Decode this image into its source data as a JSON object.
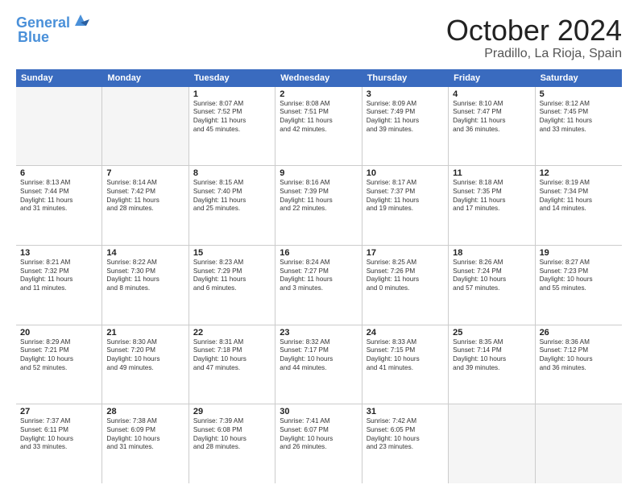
{
  "header": {
    "logo_line1": "General",
    "logo_line2": "Blue",
    "month": "October 2024",
    "location": "Pradillo, La Rioja, Spain"
  },
  "weekdays": [
    "Sunday",
    "Monday",
    "Tuesday",
    "Wednesday",
    "Thursday",
    "Friday",
    "Saturday"
  ],
  "rows": [
    [
      {
        "day": "",
        "lines": [],
        "empty": true
      },
      {
        "day": "",
        "lines": [],
        "empty": true
      },
      {
        "day": "1",
        "lines": [
          "Sunrise: 8:07 AM",
          "Sunset: 7:52 PM",
          "Daylight: 11 hours",
          "and 45 minutes."
        ]
      },
      {
        "day": "2",
        "lines": [
          "Sunrise: 8:08 AM",
          "Sunset: 7:51 PM",
          "Daylight: 11 hours",
          "and 42 minutes."
        ]
      },
      {
        "day": "3",
        "lines": [
          "Sunrise: 8:09 AM",
          "Sunset: 7:49 PM",
          "Daylight: 11 hours",
          "and 39 minutes."
        ]
      },
      {
        "day": "4",
        "lines": [
          "Sunrise: 8:10 AM",
          "Sunset: 7:47 PM",
          "Daylight: 11 hours",
          "and 36 minutes."
        ]
      },
      {
        "day": "5",
        "lines": [
          "Sunrise: 8:12 AM",
          "Sunset: 7:45 PM",
          "Daylight: 11 hours",
          "and 33 minutes."
        ]
      }
    ],
    [
      {
        "day": "6",
        "lines": [
          "Sunrise: 8:13 AM",
          "Sunset: 7:44 PM",
          "Daylight: 11 hours",
          "and 31 minutes."
        ]
      },
      {
        "day": "7",
        "lines": [
          "Sunrise: 8:14 AM",
          "Sunset: 7:42 PM",
          "Daylight: 11 hours",
          "and 28 minutes."
        ]
      },
      {
        "day": "8",
        "lines": [
          "Sunrise: 8:15 AM",
          "Sunset: 7:40 PM",
          "Daylight: 11 hours",
          "and 25 minutes."
        ]
      },
      {
        "day": "9",
        "lines": [
          "Sunrise: 8:16 AM",
          "Sunset: 7:39 PM",
          "Daylight: 11 hours",
          "and 22 minutes."
        ]
      },
      {
        "day": "10",
        "lines": [
          "Sunrise: 8:17 AM",
          "Sunset: 7:37 PM",
          "Daylight: 11 hours",
          "and 19 minutes."
        ]
      },
      {
        "day": "11",
        "lines": [
          "Sunrise: 8:18 AM",
          "Sunset: 7:35 PM",
          "Daylight: 11 hours",
          "and 17 minutes."
        ]
      },
      {
        "day": "12",
        "lines": [
          "Sunrise: 8:19 AM",
          "Sunset: 7:34 PM",
          "Daylight: 11 hours",
          "and 14 minutes."
        ]
      }
    ],
    [
      {
        "day": "13",
        "lines": [
          "Sunrise: 8:21 AM",
          "Sunset: 7:32 PM",
          "Daylight: 11 hours",
          "and 11 minutes."
        ]
      },
      {
        "day": "14",
        "lines": [
          "Sunrise: 8:22 AM",
          "Sunset: 7:30 PM",
          "Daylight: 11 hours",
          "and 8 minutes."
        ]
      },
      {
        "day": "15",
        "lines": [
          "Sunrise: 8:23 AM",
          "Sunset: 7:29 PM",
          "Daylight: 11 hours",
          "and 6 minutes."
        ]
      },
      {
        "day": "16",
        "lines": [
          "Sunrise: 8:24 AM",
          "Sunset: 7:27 PM",
          "Daylight: 11 hours",
          "and 3 minutes."
        ]
      },
      {
        "day": "17",
        "lines": [
          "Sunrise: 8:25 AM",
          "Sunset: 7:26 PM",
          "Daylight: 11 hours",
          "and 0 minutes."
        ]
      },
      {
        "day": "18",
        "lines": [
          "Sunrise: 8:26 AM",
          "Sunset: 7:24 PM",
          "Daylight: 10 hours",
          "and 57 minutes."
        ]
      },
      {
        "day": "19",
        "lines": [
          "Sunrise: 8:27 AM",
          "Sunset: 7:23 PM",
          "Daylight: 10 hours",
          "and 55 minutes."
        ]
      }
    ],
    [
      {
        "day": "20",
        "lines": [
          "Sunrise: 8:29 AM",
          "Sunset: 7:21 PM",
          "Daylight: 10 hours",
          "and 52 minutes."
        ]
      },
      {
        "day": "21",
        "lines": [
          "Sunrise: 8:30 AM",
          "Sunset: 7:20 PM",
          "Daylight: 10 hours",
          "and 49 minutes."
        ]
      },
      {
        "day": "22",
        "lines": [
          "Sunrise: 8:31 AM",
          "Sunset: 7:18 PM",
          "Daylight: 10 hours",
          "and 47 minutes."
        ]
      },
      {
        "day": "23",
        "lines": [
          "Sunrise: 8:32 AM",
          "Sunset: 7:17 PM",
          "Daylight: 10 hours",
          "and 44 minutes."
        ]
      },
      {
        "day": "24",
        "lines": [
          "Sunrise: 8:33 AM",
          "Sunset: 7:15 PM",
          "Daylight: 10 hours",
          "and 41 minutes."
        ]
      },
      {
        "day": "25",
        "lines": [
          "Sunrise: 8:35 AM",
          "Sunset: 7:14 PM",
          "Daylight: 10 hours",
          "and 39 minutes."
        ]
      },
      {
        "day": "26",
        "lines": [
          "Sunrise: 8:36 AM",
          "Sunset: 7:12 PM",
          "Daylight: 10 hours",
          "and 36 minutes."
        ]
      }
    ],
    [
      {
        "day": "27",
        "lines": [
          "Sunrise: 7:37 AM",
          "Sunset: 6:11 PM",
          "Daylight: 10 hours",
          "and 33 minutes."
        ]
      },
      {
        "day": "28",
        "lines": [
          "Sunrise: 7:38 AM",
          "Sunset: 6:09 PM",
          "Daylight: 10 hours",
          "and 31 minutes."
        ]
      },
      {
        "day": "29",
        "lines": [
          "Sunrise: 7:39 AM",
          "Sunset: 6:08 PM",
          "Daylight: 10 hours",
          "and 28 minutes."
        ]
      },
      {
        "day": "30",
        "lines": [
          "Sunrise: 7:41 AM",
          "Sunset: 6:07 PM",
          "Daylight: 10 hours",
          "and 26 minutes."
        ]
      },
      {
        "day": "31",
        "lines": [
          "Sunrise: 7:42 AM",
          "Sunset: 6:05 PM",
          "Daylight: 10 hours",
          "and 23 minutes."
        ]
      },
      {
        "day": "",
        "lines": [],
        "empty": true
      },
      {
        "day": "",
        "lines": [],
        "empty": true
      }
    ]
  ]
}
